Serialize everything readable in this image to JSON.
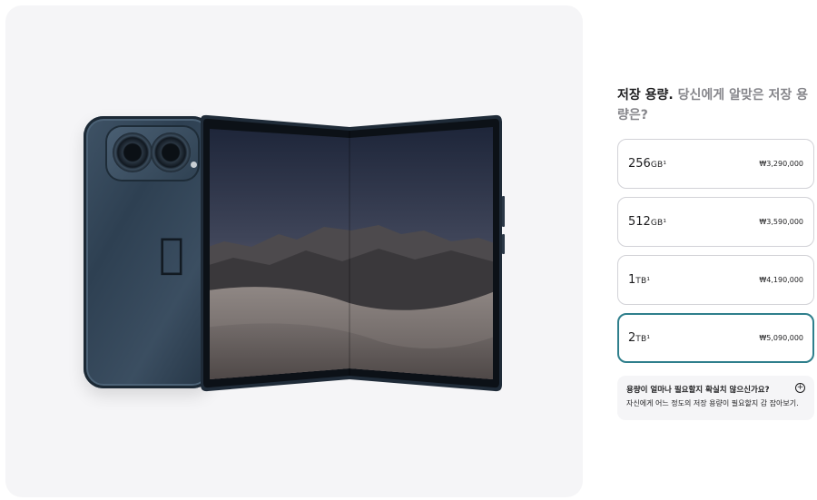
{
  "gallery": {
    "product_image_name": "phone-fold-image",
    "logo_glyph": "apple-logo-icon"
  },
  "storage": {
    "heading_bold": "저장 용량.",
    "heading_sub": " 당신에게 알맞은 저장 용량은?",
    "options": [
      {
        "capacity": "256",
        "unit": "GB¹",
        "price": "₩3,290,000",
        "selected": false
      },
      {
        "capacity": "512",
        "unit": "GB¹",
        "price": "₩3,590,000",
        "selected": false
      },
      {
        "capacity": "1",
        "unit": "TB¹",
        "price": "₩4,190,000",
        "selected": false
      },
      {
        "capacity": "2",
        "unit": "TB¹",
        "price": "₩5,090,000",
        "selected": true
      }
    ],
    "help": {
      "title": "용량이 얼마나 필요할지 확실치 않으신가요?",
      "description": "자신에게 어느 정도의 저장 용량이 필요할지 감 잡아보기.",
      "icon": "plus-circle-icon",
      "icon_glyph": "+"
    }
  },
  "colors": {
    "selected_border": "#2f7f8c",
    "default_border": "#d2d2d7",
    "panel_bg": "#f5f5f7"
  }
}
